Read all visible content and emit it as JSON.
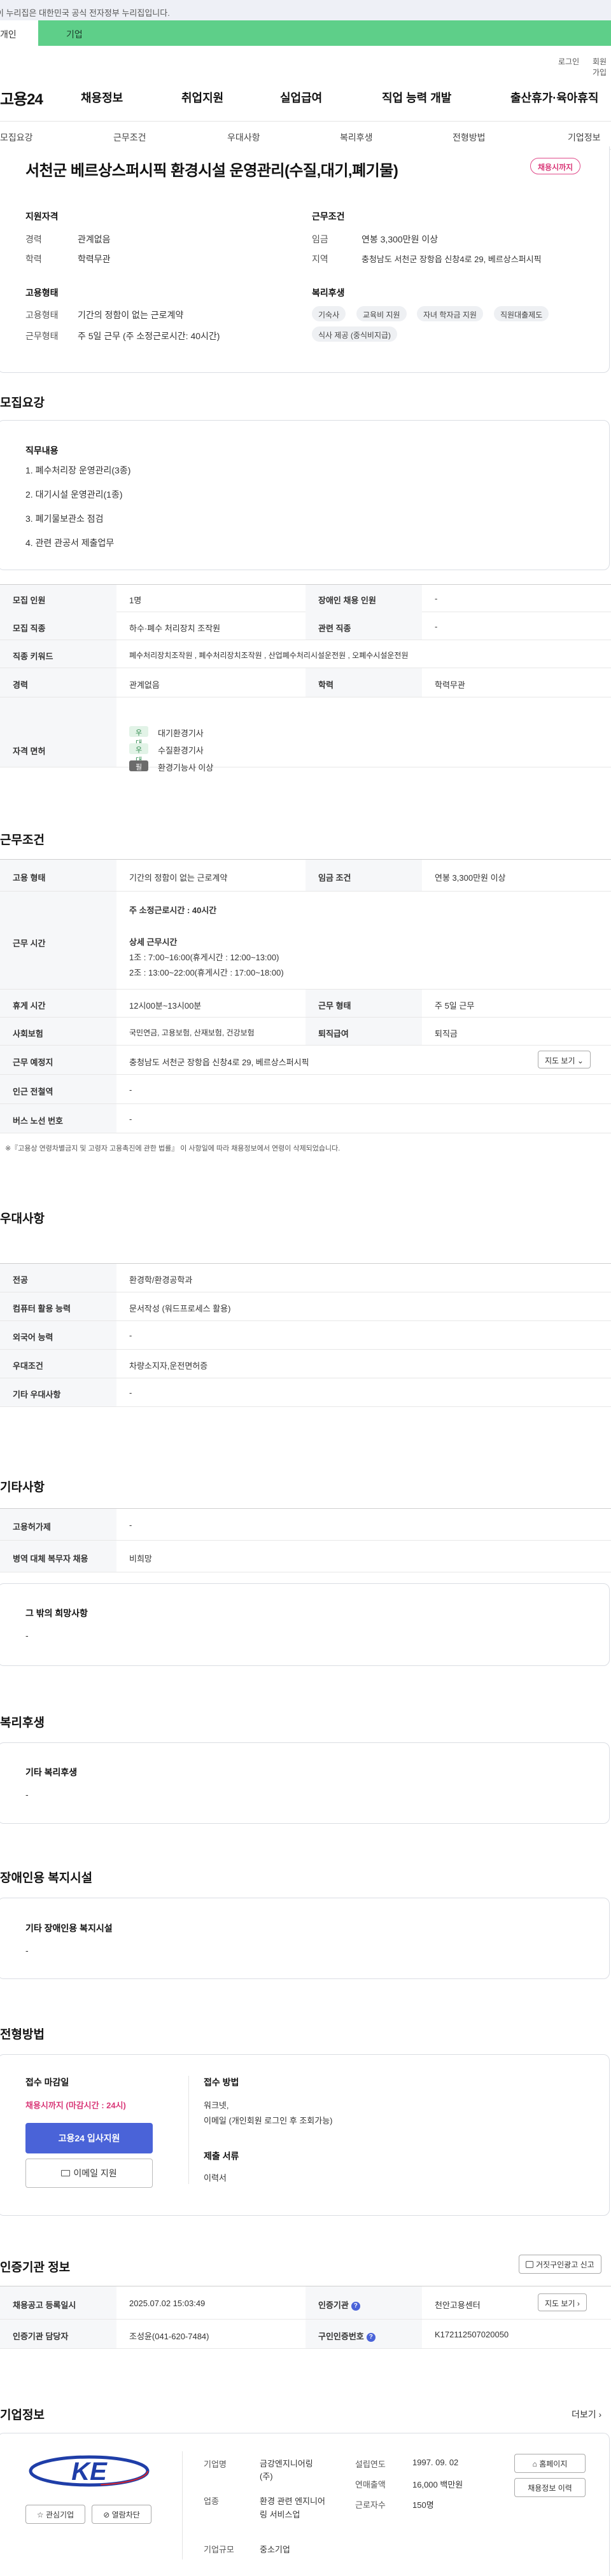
{
  "gov_banner": "이 누리집은 대한민국 공식 전자정부 누리집입니다.",
  "tabs": {
    "individual": "개인",
    "business": "기업"
  },
  "util": {
    "login": "로그인",
    "join": "회원가입"
  },
  "logo": "고용24",
  "gnb": [
    "채용정보",
    "취업지원",
    "실업급여",
    "직업 능력 개발",
    "출산휴가·육아휴직"
  ],
  "subnav": [
    "모집요강",
    "근무조건",
    "우대사항",
    "복리후생",
    "전형방법",
    "기업정보"
  ],
  "job": {
    "title": "서천군 베르상스퍼시픽 환경시설 운영관리(수질,대기,폐기물)",
    "badge": "채용시까지",
    "qual_head": "지원자격",
    "career_lbl": "경력",
    "career": "관계없음",
    "edu_lbl": "학력",
    "edu": "학력무관",
    "cond_head": "근무조건",
    "wage_lbl": "임금",
    "wage": "연봉 3,300만원 이상",
    "region_lbl": "지역",
    "region": "충청남도 서천군 장항읍 신창4로 29, 베르상스퍼시픽",
    "emp_head": "고용형태",
    "emptype_lbl": "고용형태",
    "emptype": "기간의 정함이 없는 근로계약",
    "worktype_lbl": "근무형태",
    "worktype": "주 5일 근무 (주 소정근로시간: 40시간)",
    "welfare_head": "복리후생",
    "welfare_chips": [
      "기숙사",
      "교육비 지원",
      "자녀 학자금 지원",
      "직원대출제도",
      "식사 제공 (중식비지급)"
    ]
  },
  "recruit": {
    "section": "모집요강",
    "duty_head": "직무내용",
    "duties": [
      "1. 폐수처리장 운영관리(3종)",
      "2. 대기시설 운영관리(1종)",
      "3. 폐기물보관소 점검",
      "4. 관련 관공서 제출업무"
    ],
    "count_lbl": "모집 인원",
    "count": "1명",
    "disabled_lbl": "장애인 채용 인원",
    "disabled": "-",
    "job_lbl": "모집 직종",
    "job": "하수·폐수 처리장치 조작원",
    "related_lbl": "관련 직종",
    "related": "-",
    "kw_lbl": "직종 키워드",
    "kw": "폐수처리장치조작원 , 폐수처리장치조작원 , 산업폐수처리시설운전원 , 오폐수시설운전원",
    "career_lbl": "경력",
    "career": "관계없음",
    "edu_lbl": "학력",
    "edu": "학력무관",
    "lic_lbl": "자격 면허",
    "licenses": [
      {
        "tag": "우대",
        "name": "대기환경기사"
      },
      {
        "tag": "우대",
        "name": "수질환경기사"
      },
      {
        "tag": "필수",
        "name": "환경기능사 이상"
      }
    ]
  },
  "work": {
    "section": "근무조건",
    "emp_lbl": "고용 형태",
    "emp": "기간의 정함이 없는 근로계약",
    "wage_lbl": "임금 조건",
    "wage": "연봉 3,300만원 이상",
    "time_lbl": "근무 시간",
    "time_main": "주 소정근로시간 : 40시간",
    "time_detail": "상세 근무시간",
    "time_1": "1조 :  7:00~16:00(휴게시간 : 12:00~13:00)",
    "time_2": "2조 :  13:00~22:00(휴게시간 : 17:00~18:00)",
    "rest_lbl": "휴게 시간",
    "rest": "12시00분~13시00분",
    "form_lbl": "근무 형태",
    "form": "주 5일 근무",
    "ins_lbl": "사회보험",
    "ins": "국민연금, 고용보험, 산재보험, 건강보험",
    "pension_lbl": "퇴직급여",
    "pension": "퇴직금",
    "place_lbl": "근무 예정지",
    "place": "충청남도 서천군 장항읍 신창4로 29, 베르상스퍼시픽",
    "map_btn": "지도 보기",
    "station_lbl": "인근 전철역",
    "station": "-",
    "bus_lbl": "버스 노선 번호",
    "bus": "-",
    "note": "※『고용상 연령차별금지 및 고령자 고용촉진에 관한 법률』 이 사항일에 따라 채용정보에서 연령이 삭제되었습니다."
  },
  "pref": {
    "section": "우대사항",
    "major_lbl": "전공",
    "major": "환경학/환경공학과",
    "pc_lbl": "컴퓨터 활용 능력",
    "pc": "문서작성 (워드프로세스 활용)",
    "lang_lbl": "외국어 능력",
    "lang": "-",
    "cond_lbl": "우대조건",
    "cond": "차량소지자,운전면허증",
    "etc_lbl": "기타 우대사항",
    "etc": "-"
  },
  "other": {
    "section": "기타사항",
    "plan_lbl": "고용허가제",
    "plan": "-",
    "mil_lbl": "병역 대체 복무자 채용",
    "mil": "비희망",
    "wish_head": "그 밖의 희망사항",
    "wish": "-"
  },
  "benefit": {
    "section": "복리후생",
    "head": "기타 복리후생",
    "val": "-"
  },
  "disab": {
    "section": "장애인용 복지시설",
    "head": "기타 장애인용 복지시설",
    "val": "-"
  },
  "select": {
    "section": "전형방법",
    "deadline_head": "접수 마감일",
    "deadline": "채용시까지 (마감시간 : 24시)",
    "apply_btn": "고용24 입사지원",
    "email_btn": "이메일 지원",
    "method_head": "접수 방법",
    "method_1": "워크넷,",
    "method_2": "이메일 (개인회원 로그인 후 조회가능)",
    "docs_head": "제출 서류",
    "docs": "이력서"
  },
  "agency": {
    "section": "인증기관 정보",
    "report_btn": "거짓구인광고 신고",
    "reg_lbl": "채용공고 등록일시",
    "reg": "2025.07.02 15:03:49",
    "org_lbl": "인증기관",
    "org": "천안고용센터",
    "map_btn": "지도 보기",
    "mgr_lbl": "인증기관 담당자",
    "mgr": "조성윤(041-620-7484)",
    "no_lbl": "구인인증번호",
    "no": "K172112507020050"
  },
  "company": {
    "section": "기업정보",
    "more": "더보기",
    "logo_text": "KE",
    "fav_btn": "관심기업",
    "block_btn": "열람차단",
    "name_lbl": "기업명",
    "name": "금강엔지니어링(주)",
    "found_lbl": "설립연도",
    "found": "1997. 09. 02",
    "sector_lbl": "업종",
    "sector": "환경 관련 엔지니어링 서비스업",
    "sales_lbl": "연매출액",
    "sales": "16,000 백만원",
    "emp_lbl": "근로자수",
    "emp": "150명",
    "size_lbl": "기업규모",
    "size": "중소기업",
    "home_btn": "홈페이지",
    "info_btn": "채용정보 이력"
  },
  "colors": {
    "brand_green": "#5ecf89",
    "accent_pink": "#d93878",
    "accent_blue": "#4a63d8"
  }
}
